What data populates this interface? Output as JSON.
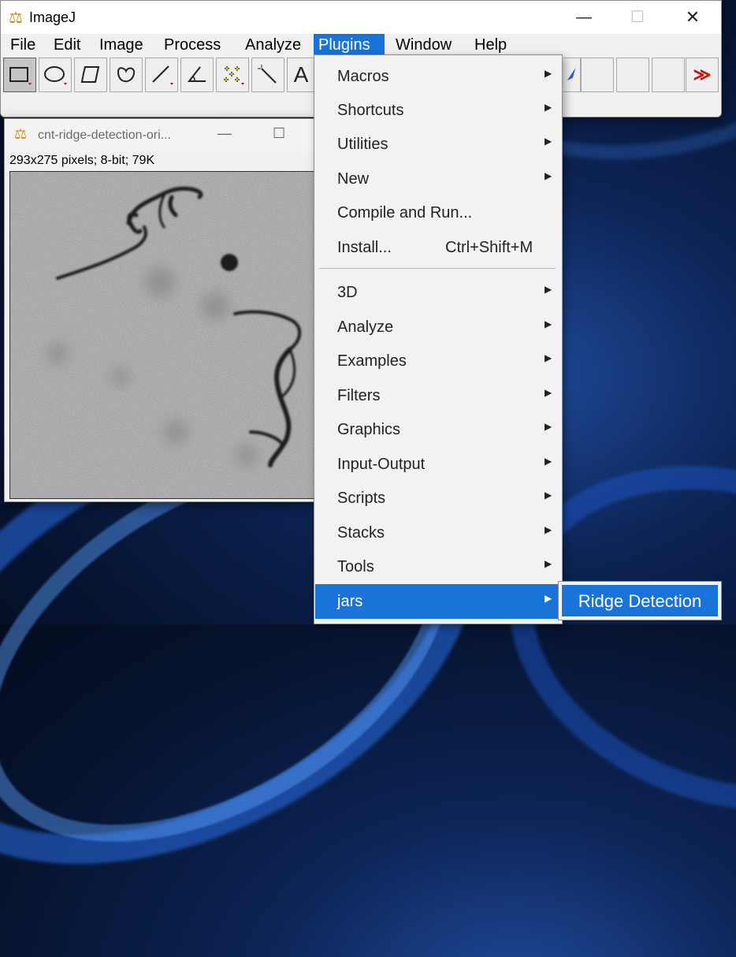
{
  "main_window": {
    "title": "ImageJ",
    "controls": {
      "minimize": "—",
      "maximize": "☐",
      "close": "✕"
    }
  },
  "menubar": {
    "items": [
      {
        "label": "File"
      },
      {
        "label": "Edit"
      },
      {
        "label": "Image"
      },
      {
        "label": "Process"
      },
      {
        "label": "Analyze"
      },
      {
        "label": "Plugins",
        "active": true
      },
      {
        "label": "Window"
      },
      {
        "label": "Help"
      }
    ]
  },
  "toolbar": {
    "tools": [
      {
        "icon": "rectangle-tool-icon",
        "selected": true
      },
      {
        "icon": "oval-tool-icon"
      },
      {
        "icon": "polygon-tool-icon"
      },
      {
        "icon": "freehand-tool-icon"
      },
      {
        "icon": "line-tool-icon"
      },
      {
        "icon": "angle-tool-icon"
      },
      {
        "icon": "multipoint-tool-icon"
      },
      {
        "icon": "wand-tool-icon"
      },
      {
        "icon": "text-tool-icon",
        "glyph": "A"
      },
      {
        "icon": "dropper-tool-icon"
      },
      {
        "icon": "blank-tool-slot"
      },
      {
        "icon": "blank-tool-slot"
      },
      {
        "icon": "blank-tool-slot"
      },
      {
        "icon": "more-tools-icon",
        "glyph": "≫"
      }
    ]
  },
  "image_window": {
    "title": "cnt-ridge-detection-ori...",
    "info": "293x275 pixels; 8-bit; 79K",
    "controls": {
      "minimize": "—",
      "maximize": "☐"
    }
  },
  "plugins_menu": {
    "items": [
      {
        "label": "Macros",
        "submenu": true
      },
      {
        "label": "Shortcuts",
        "submenu": true
      },
      {
        "label": "Utilities",
        "submenu": true
      },
      {
        "label": "New",
        "submenu": true
      },
      {
        "label": "Compile and Run...",
        "submenu": false
      },
      {
        "label": "Install...",
        "shortcut": "Ctrl+Shift+M",
        "submenu": false
      },
      {
        "separator": true
      },
      {
        "label": "3D",
        "submenu": true
      },
      {
        "label": "Analyze",
        "submenu": true
      },
      {
        "label": "Examples",
        "submenu": true
      },
      {
        "label": "Filters",
        "submenu": true
      },
      {
        "label": "Graphics",
        "submenu": true
      },
      {
        "label": "Input-Output",
        "submenu": true
      },
      {
        "label": "Scripts",
        "submenu": true
      },
      {
        "label": "Stacks",
        "submenu": true
      },
      {
        "label": "Tools",
        "submenu": true
      },
      {
        "label": "jars",
        "submenu": true,
        "highlighted": true
      }
    ],
    "submenu_arrow": "▶"
  },
  "jars_submenu": {
    "items": [
      {
        "label": "Ridge Detection",
        "highlighted": true
      }
    ]
  },
  "colors": {
    "highlight": "#1a73d8",
    "menu_bg": "#f2f2f2",
    "window_bg": "#f0f0f0"
  }
}
